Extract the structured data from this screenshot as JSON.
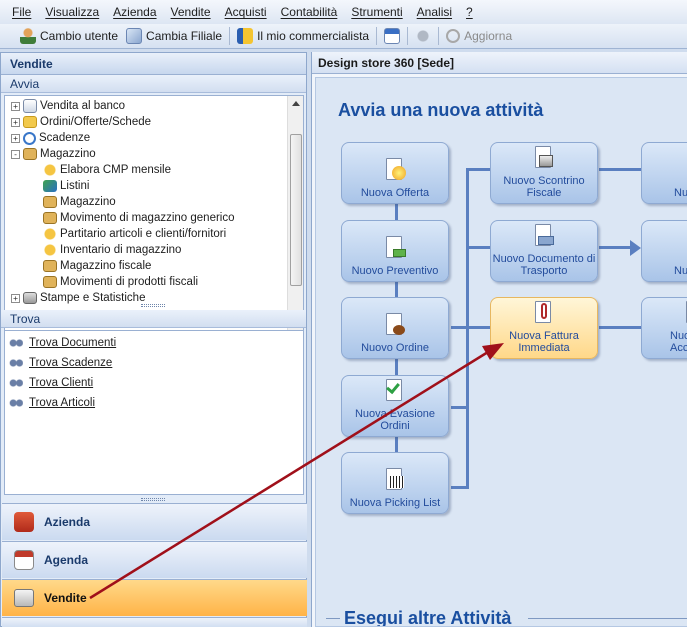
{
  "menubar": {
    "items": [
      "File",
      "Visualizza",
      "Azienda",
      "Vendite",
      "Acquisti",
      "Contabilità",
      "Strumenti",
      "Analisi",
      "?"
    ]
  },
  "toolbar": {
    "cambio_utente": "Cambio utente",
    "cambia_filiale": "Cambia Filiale",
    "commercialista": "Il mio commercialista",
    "aggiorna": "Aggiorna"
  },
  "left_panel": {
    "title": "Vendite",
    "avvia_title": "Avvia",
    "tree": [
      {
        "label": "Vendita al banco",
        "level": 0,
        "expander": "+"
      },
      {
        "label": "Ordini/Offerte/Schede",
        "level": 0,
        "expander": "+"
      },
      {
        "label": "Scadenze",
        "level": 0,
        "expander": "+"
      },
      {
        "label": "Magazzino",
        "level": 0,
        "expander": "-"
      },
      {
        "label": "Elabora CMP mensile",
        "level": 1
      },
      {
        "label": "Listini",
        "level": 1
      },
      {
        "label": "Magazzino",
        "level": 1
      },
      {
        "label": "Movimento di magazzino generico",
        "level": 1
      },
      {
        "label": "Partitario articoli e clienti/fornitori",
        "level": 1
      },
      {
        "label": "Inventario di magazzino",
        "level": 1
      },
      {
        "label": "Magazzino fiscale",
        "level": 1
      },
      {
        "label": "Movimenti di prodotti fiscali",
        "level": 1
      },
      {
        "label": "Stampe e Statistiche",
        "level": 0,
        "expander": "+"
      }
    ],
    "trova_title": "Trova",
    "trova_links": [
      "Trova Documenti",
      "Trova Scadenze",
      "Trova Clienti",
      "Trova Articoli"
    ],
    "nav": {
      "azienda": "Azienda",
      "agenda": "Agenda",
      "vendite": "Vendite"
    }
  },
  "content": {
    "title": "Design store 360 [Sede]",
    "section_title": "Avvia una nuova attività",
    "section2_title": "Esegui altre Attività",
    "activities": {
      "offerta": "Nuova Offerta",
      "preventivo": "Nuovo Preventivo",
      "ordine": "Nuovo Ordine",
      "evasione": "Nuova Evasione Ordini",
      "picking": "Nuova Picking List",
      "scontrino": "Nuovo Scontrino Fiscale",
      "ddt": "Nuovo Documento di Trasporto",
      "fattura": "Nuova Fattura Immediata",
      "col3_a": "Nuova Fis",
      "col3_b": "Nuov Dif",
      "col3_c": "Nuov Accomp"
    }
  },
  "colors": {
    "accent": "#1a4fa0",
    "annotation_arrow": "#a0101a",
    "active_nav": "#ffb347"
  }
}
